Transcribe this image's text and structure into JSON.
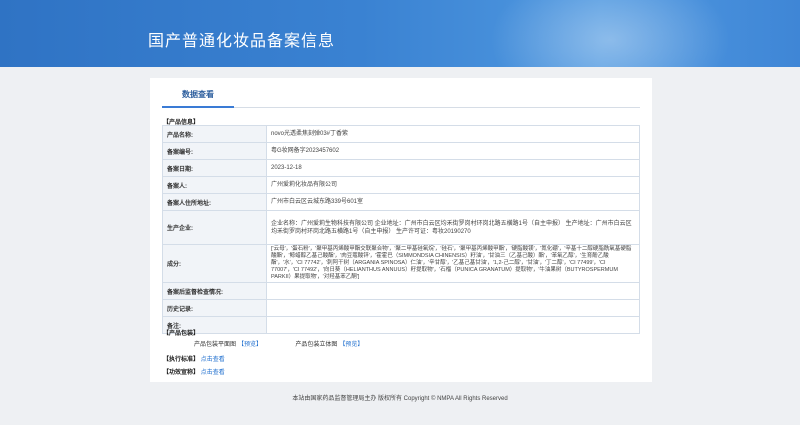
{
  "header": {
    "title": "国产普通化妆品备案信息"
  },
  "tab": {
    "label": "数据查看"
  },
  "product_info": {
    "section_title": "【产品信息】",
    "rows": [
      {
        "label": "产品名称:",
        "value": "novo光透柔焦刻弹03#丁香紫"
      },
      {
        "label": "备案编号:",
        "value": "粤G妆网备字2023457602"
      },
      {
        "label": "备案日期:",
        "value": "2023-12-18"
      },
      {
        "label": "备案人:",
        "value": "广州爱莉化妆品有限公司"
      },
      {
        "label": "备案人住所地址:",
        "value": "广州市白云区云城东路339号601室"
      },
      {
        "label": "生产企业:",
        "value": "企业名称：广州爱莉生物科技有限公司 企业地址：广州市白云区均禾街罗岗村环岗北路五横路1号（自主申报） 生产地址：广州市白云区均禾街罗岗村环岗北路五横路1号（自主申报） 生产许可证：粤妆20190270"
      },
      {
        "label": "成分:",
        "value": "['云母'，'蛋石粉'，'聚甲基丙烯酸甲酯交联聚合物'，'聚二甲基硅氧烷'，'硅石'，'聚甲基丙烯酸甲酯'，'硬脂酸镁'，'氮化硼'，'辛基十二醇硬脂酰氧基硬脂酸酯'，'鲸蜡醇乙基己酸酯'，'肉豆蔻酸锌'，'霍霍巴（SIMMONDSIA CHINENSIS）籽油'，'甘油三（乙基己酸）酯'，'苯氧乙醇'，'生育酚乙酸酯'，'水'，'CI 77742'，'刺阿干树（ARGANIA SPINOSA）仁油'，'辛甘醇'，'乙基己基甘油'，'1,2-己二醇'，'甘油'，'丁二醇'，'CI 77499'，'CI 77007'，'CI 77492'，'向日葵（HELIANTHUS ANNUUS）籽提取物'，'石榴（PUNICA GRANATUM）提取物'，'牛油果树（BUTYROSPERMUM PARKII）果提取物'，'对羟基苯乙酮']"
      },
      {
        "label": "备案后监督检查情况:",
        "value": ""
      },
      {
        "label": "历史记录:",
        "value": ""
      },
      {
        "label": "备注:",
        "value": ""
      }
    ]
  },
  "packaging": {
    "section_title": "【产品包装】",
    "flat_label": "产品包装平面图",
    "flat_link": "【预览】",
    "solid_label": "产品包装立体图",
    "solid_link": "【预览】"
  },
  "standard": {
    "label": "【执行标准】",
    "link": "点击查看"
  },
  "efficacy": {
    "label": "【功效宣称】",
    "link": "点击查看"
  },
  "footer": {
    "text": "本站由国家药品监督管理局主办 版权所有 Copyright © NMPA All Rights Reserved"
  }
}
